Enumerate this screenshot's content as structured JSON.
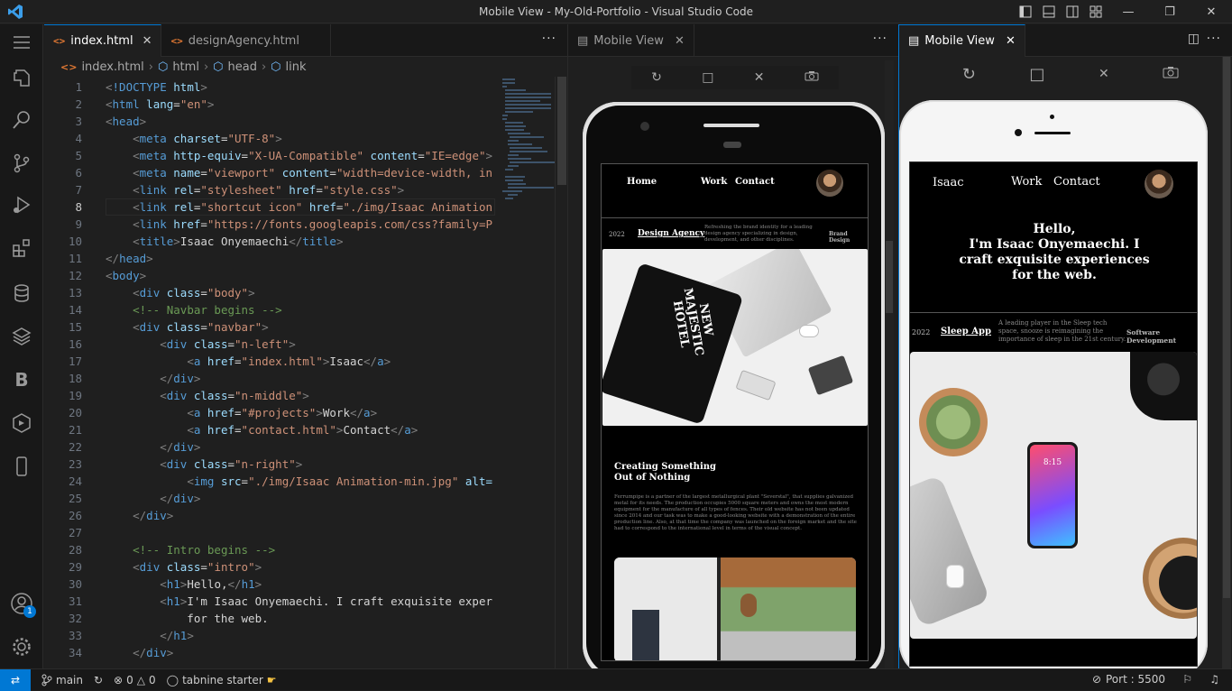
{
  "window": {
    "title": "Mobile View - My-Old-Portfolio - Visual Studio Code"
  },
  "activity": [
    "explorer-icon",
    "search-icon",
    "source-control-icon",
    "run-debug-icon",
    "extensions-icon",
    "database-icon",
    "layers-icon",
    "bootstrap-icon",
    "remote-explorer-icon",
    "mobile-icon",
    "account-icon",
    "gear-icon"
  ],
  "account_badge": "1",
  "editor": {
    "tabs": [
      {
        "label": "index.html",
        "active": true
      },
      {
        "label": "designAgency.html",
        "active": false
      }
    ],
    "breadcrumb": [
      "index.html",
      "html",
      "head",
      "link"
    ],
    "lines": [
      [
        [
          "#808080",
          "<"
        ],
        [
          "#569cd6",
          "!DOCTYPE"
        ],
        [
          "#d4d4d4",
          " "
        ],
        [
          "#9cdcfe",
          "html"
        ],
        [
          "#808080",
          ">"
        ]
      ],
      [
        [
          "#808080",
          "<"
        ],
        [
          "#569cd6",
          "html"
        ],
        [
          "#d4d4d4",
          " "
        ],
        [
          "#9cdcfe",
          "lang"
        ],
        [
          "#d4d4d4",
          "="
        ],
        [
          "#ce9178",
          "\"en\""
        ],
        [
          "#808080",
          ">"
        ]
      ],
      [
        [
          "#808080",
          "<"
        ],
        [
          "#569cd6",
          "head"
        ],
        [
          "#808080",
          ">"
        ]
      ],
      [
        [
          "#d4d4d4",
          "    "
        ],
        [
          "#808080",
          "<"
        ],
        [
          "#569cd6",
          "meta"
        ],
        [
          "#d4d4d4",
          " "
        ],
        [
          "#9cdcfe",
          "charset"
        ],
        [
          "#d4d4d4",
          "="
        ],
        [
          "#ce9178",
          "\"UTF-8\""
        ],
        [
          "#808080",
          ">"
        ]
      ],
      [
        [
          "#d4d4d4",
          "    "
        ],
        [
          "#808080",
          "<"
        ],
        [
          "#569cd6",
          "meta"
        ],
        [
          "#d4d4d4",
          " "
        ],
        [
          "#9cdcfe",
          "http-equiv"
        ],
        [
          "#d4d4d4",
          "="
        ],
        [
          "#ce9178",
          "\"X-UA-Compatible\""
        ],
        [
          "#d4d4d4",
          " "
        ],
        [
          "#9cdcfe",
          "content"
        ],
        [
          "#d4d4d4",
          "="
        ],
        [
          "#ce9178",
          "\"IE=edge\""
        ],
        [
          "#808080",
          ">"
        ]
      ],
      [
        [
          "#d4d4d4",
          "    "
        ],
        [
          "#808080",
          "<"
        ],
        [
          "#569cd6",
          "meta"
        ],
        [
          "#d4d4d4",
          " "
        ],
        [
          "#9cdcfe",
          "name"
        ],
        [
          "#d4d4d4",
          "="
        ],
        [
          "#ce9178",
          "\"viewport\""
        ],
        [
          "#d4d4d4",
          " "
        ],
        [
          "#9cdcfe",
          "content"
        ],
        [
          "#d4d4d4",
          "="
        ],
        [
          "#ce9178",
          "\"width=device-width, in"
        ]
      ],
      [
        [
          "#d4d4d4",
          "    "
        ],
        [
          "#808080",
          "<"
        ],
        [
          "#569cd6",
          "link"
        ],
        [
          "#d4d4d4",
          " "
        ],
        [
          "#9cdcfe",
          "rel"
        ],
        [
          "#d4d4d4",
          "="
        ],
        [
          "#ce9178",
          "\"stylesheet\""
        ],
        [
          "#d4d4d4",
          " "
        ],
        [
          "#9cdcfe",
          "href"
        ],
        [
          "#d4d4d4",
          "="
        ],
        [
          "#ce9178",
          "\"style.css\""
        ],
        [
          "#808080",
          ">"
        ]
      ],
      [
        [
          "#d4d4d4",
          "    "
        ],
        [
          "#808080",
          "<"
        ],
        [
          "#569cd6",
          "link"
        ],
        [
          "#d4d4d4",
          " "
        ],
        [
          "#9cdcfe",
          "rel"
        ],
        [
          "#d4d4d4",
          "="
        ],
        [
          "#ce9178",
          "\"shortcut icon\""
        ],
        [
          "#d4d4d4",
          " "
        ],
        [
          "#9cdcfe",
          "href"
        ],
        [
          "#d4d4d4",
          "="
        ],
        [
          "#ce9178",
          "\"./img/Isaac Animation"
        ]
      ],
      [
        [
          "#d4d4d4",
          "    "
        ],
        [
          "#808080",
          "<"
        ],
        [
          "#569cd6",
          "link"
        ],
        [
          "#d4d4d4",
          " "
        ],
        [
          "#9cdcfe",
          "href"
        ],
        [
          "#d4d4d4",
          "="
        ],
        [
          "#ce9178",
          "\"https://fonts.googleapis.com/css?family=P"
        ]
      ],
      [
        [
          "#d4d4d4",
          "    "
        ],
        [
          "#808080",
          "<"
        ],
        [
          "#569cd6",
          "title"
        ],
        [
          "#808080",
          ">"
        ],
        [
          "#d4d4d4",
          "Isaac Onyemaechi"
        ],
        [
          "#808080",
          "</"
        ],
        [
          "#569cd6",
          "title"
        ],
        [
          "#808080",
          ">"
        ]
      ],
      [
        [
          "#808080",
          "</"
        ],
        [
          "#569cd6",
          "head"
        ],
        [
          "#808080",
          ">"
        ]
      ],
      [
        [
          "#808080",
          "<"
        ],
        [
          "#569cd6",
          "body"
        ],
        [
          "#808080",
          ">"
        ]
      ],
      [
        [
          "#d4d4d4",
          "    "
        ],
        [
          "#808080",
          "<"
        ],
        [
          "#569cd6",
          "div"
        ],
        [
          "#d4d4d4",
          " "
        ],
        [
          "#9cdcfe",
          "class"
        ],
        [
          "#d4d4d4",
          "="
        ],
        [
          "#ce9178",
          "\"body\""
        ],
        [
          "#808080",
          ">"
        ]
      ],
      [
        [
          "#d4d4d4",
          "    "
        ],
        [
          "#6a9955",
          "<!-- Navbar begins -->"
        ]
      ],
      [
        [
          "#d4d4d4",
          "    "
        ],
        [
          "#808080",
          "<"
        ],
        [
          "#569cd6",
          "div"
        ],
        [
          "#d4d4d4",
          " "
        ],
        [
          "#9cdcfe",
          "class"
        ],
        [
          "#d4d4d4",
          "="
        ],
        [
          "#ce9178",
          "\"navbar\""
        ],
        [
          "#808080",
          ">"
        ]
      ],
      [
        [
          "#d4d4d4",
          "        "
        ],
        [
          "#808080",
          "<"
        ],
        [
          "#569cd6",
          "div"
        ],
        [
          "#d4d4d4",
          " "
        ],
        [
          "#9cdcfe",
          "class"
        ],
        [
          "#d4d4d4",
          "="
        ],
        [
          "#ce9178",
          "\"n-left\""
        ],
        [
          "#808080",
          ">"
        ]
      ],
      [
        [
          "#d4d4d4",
          "            "
        ],
        [
          "#808080",
          "<"
        ],
        [
          "#569cd6",
          "a"
        ],
        [
          "#d4d4d4",
          " "
        ],
        [
          "#9cdcfe",
          "href"
        ],
        [
          "#d4d4d4",
          "="
        ],
        [
          "#ce9178",
          "\"index.html\""
        ],
        [
          "#808080",
          ">"
        ],
        [
          "#d4d4d4",
          "Isaac"
        ],
        [
          "#808080",
          "</"
        ],
        [
          "#569cd6",
          "a"
        ],
        [
          "#808080",
          ">"
        ]
      ],
      [
        [
          "#d4d4d4",
          "        "
        ],
        [
          "#808080",
          "</"
        ],
        [
          "#569cd6",
          "div"
        ],
        [
          "#808080",
          ">"
        ]
      ],
      [
        [
          "#d4d4d4",
          "        "
        ],
        [
          "#808080",
          "<"
        ],
        [
          "#569cd6",
          "div"
        ],
        [
          "#d4d4d4",
          " "
        ],
        [
          "#9cdcfe",
          "class"
        ],
        [
          "#d4d4d4",
          "="
        ],
        [
          "#ce9178",
          "\"n-middle\""
        ],
        [
          "#808080",
          ">"
        ]
      ],
      [
        [
          "#d4d4d4",
          "            "
        ],
        [
          "#808080",
          "<"
        ],
        [
          "#569cd6",
          "a"
        ],
        [
          "#d4d4d4",
          " "
        ],
        [
          "#9cdcfe",
          "href"
        ],
        [
          "#d4d4d4",
          "="
        ],
        [
          "#ce9178",
          "\"#projects\""
        ],
        [
          "#808080",
          ">"
        ],
        [
          "#d4d4d4",
          "Work"
        ],
        [
          "#808080",
          "</"
        ],
        [
          "#569cd6",
          "a"
        ],
        [
          "#808080",
          ">"
        ]
      ],
      [
        [
          "#d4d4d4",
          "            "
        ],
        [
          "#808080",
          "<"
        ],
        [
          "#569cd6",
          "a"
        ],
        [
          "#d4d4d4",
          " "
        ],
        [
          "#9cdcfe",
          "href"
        ],
        [
          "#d4d4d4",
          "="
        ],
        [
          "#ce9178",
          "\"contact.html\""
        ],
        [
          "#808080",
          ">"
        ],
        [
          "#d4d4d4",
          "Contact"
        ],
        [
          "#808080",
          "</"
        ],
        [
          "#569cd6",
          "a"
        ],
        [
          "#808080",
          ">"
        ]
      ],
      [
        [
          "#d4d4d4",
          "        "
        ],
        [
          "#808080",
          "</"
        ],
        [
          "#569cd6",
          "div"
        ],
        [
          "#808080",
          ">"
        ]
      ],
      [
        [
          "#d4d4d4",
          "        "
        ],
        [
          "#808080",
          "<"
        ],
        [
          "#569cd6",
          "div"
        ],
        [
          "#d4d4d4",
          " "
        ],
        [
          "#9cdcfe",
          "class"
        ],
        [
          "#d4d4d4",
          "="
        ],
        [
          "#ce9178",
          "\"n-right\""
        ],
        [
          "#808080",
          ">"
        ]
      ],
      [
        [
          "#d4d4d4",
          "            "
        ],
        [
          "#808080",
          "<"
        ],
        [
          "#569cd6",
          "img"
        ],
        [
          "#d4d4d4",
          " "
        ],
        [
          "#9cdcfe",
          "src"
        ],
        [
          "#d4d4d4",
          "="
        ],
        [
          "#ce9178",
          "\"./img/Isaac Animation-min.jpg\""
        ],
        [
          "#d4d4d4",
          " "
        ],
        [
          "#9cdcfe",
          "alt="
        ]
      ],
      [
        [
          "#d4d4d4",
          "        "
        ],
        [
          "#808080",
          "</"
        ],
        [
          "#569cd6",
          "div"
        ],
        [
          "#808080",
          ">"
        ]
      ],
      [
        [
          "#d4d4d4",
          "    "
        ],
        [
          "#808080",
          "</"
        ],
        [
          "#569cd6",
          "div"
        ],
        [
          "#808080",
          ">"
        ]
      ],
      [
        [
          "#d4d4d4",
          ""
        ]
      ],
      [
        [
          "#d4d4d4",
          "    "
        ],
        [
          "#6a9955",
          "<!-- Intro begins -->"
        ]
      ],
      [
        [
          "#d4d4d4",
          "    "
        ],
        [
          "#808080",
          "<"
        ],
        [
          "#569cd6",
          "div"
        ],
        [
          "#d4d4d4",
          " "
        ],
        [
          "#9cdcfe",
          "class"
        ],
        [
          "#d4d4d4",
          "="
        ],
        [
          "#ce9178",
          "\"intro\""
        ],
        [
          "#808080",
          ">"
        ]
      ],
      [
        [
          "#d4d4d4",
          "        "
        ],
        [
          "#808080",
          "<"
        ],
        [
          "#569cd6",
          "h1"
        ],
        [
          "#808080",
          ">"
        ],
        [
          "#d4d4d4",
          "Hello,"
        ],
        [
          "#808080",
          "</"
        ],
        [
          "#569cd6",
          "h1"
        ],
        [
          "#808080",
          ">"
        ]
      ],
      [
        [
          "#d4d4d4",
          "        "
        ],
        [
          "#808080",
          "<"
        ],
        [
          "#569cd6",
          "h1"
        ],
        [
          "#808080",
          ">"
        ],
        [
          "#d4d4d4",
          "I'm Isaac Onyemaechi. I craft exquisite exper"
        ]
      ],
      [
        [
          "#d4d4d4",
          "            for the web."
        ]
      ],
      [
        [
          "#d4d4d4",
          "        "
        ],
        [
          "#808080",
          "</"
        ],
        [
          "#569cd6",
          "h1"
        ],
        [
          "#808080",
          ">"
        ]
      ],
      [
        [
          "#d4d4d4",
          "    "
        ],
        [
          "#808080",
          "</"
        ],
        [
          "#569cd6",
          "div"
        ],
        [
          "#808080",
          ">"
        ]
      ]
    ]
  },
  "panel1": {
    "tab": "Mobile View",
    "site": {
      "nav": {
        "home": "Home",
        "work": "Work",
        "contact": "Contact"
      },
      "project": {
        "year": "2022",
        "name": "Design Agency",
        "desc": "Refreshing the brand identity for a leading design agency specializing in design, development, and other disciplines.",
        "category": "Brand Design"
      },
      "bag_text": [
        "NEW",
        "MAJESTIC",
        "HOTEL"
      ],
      "heading": [
        "Creating Something",
        "Out of Nothing"
      ],
      "paragraph": "Ferrumpipe is a partner of the largest metallurgical plant \"Severstal\", that supplies galvanized metal for its needs. The production occupies 5000 square meters and owns the most modern equipment for the manufacture of all types of fences. Their old website has not been updated since 2014 and our task was to make a good-looking website with a demonstration of the entire production line. Also, at that time the company was launched on the foreign market and the site had to correspond to the international level in terms of the visual concept."
    }
  },
  "panel2": {
    "tab": "Mobile View",
    "site": {
      "nav": {
        "home": "Isaac",
        "work": "Work",
        "contact": "Contact"
      },
      "intro": [
        "Hello,",
        "I'm Isaac Onyemaechi. I",
        "craft exquisite experiences",
        "for the web."
      ],
      "project": {
        "year": "2022",
        "name": "Sleep App",
        "desc": "A leading player in the Sleep tech space, snooze is reimagining the importance of sleep in the 21st century.",
        "category": "Software Development"
      },
      "phone_time": "8:15"
    }
  },
  "statusbar": {
    "branch": "main",
    "errors": "0",
    "warnings": "0",
    "tabnine": "tabnine starter",
    "port": "Port : 5500"
  }
}
